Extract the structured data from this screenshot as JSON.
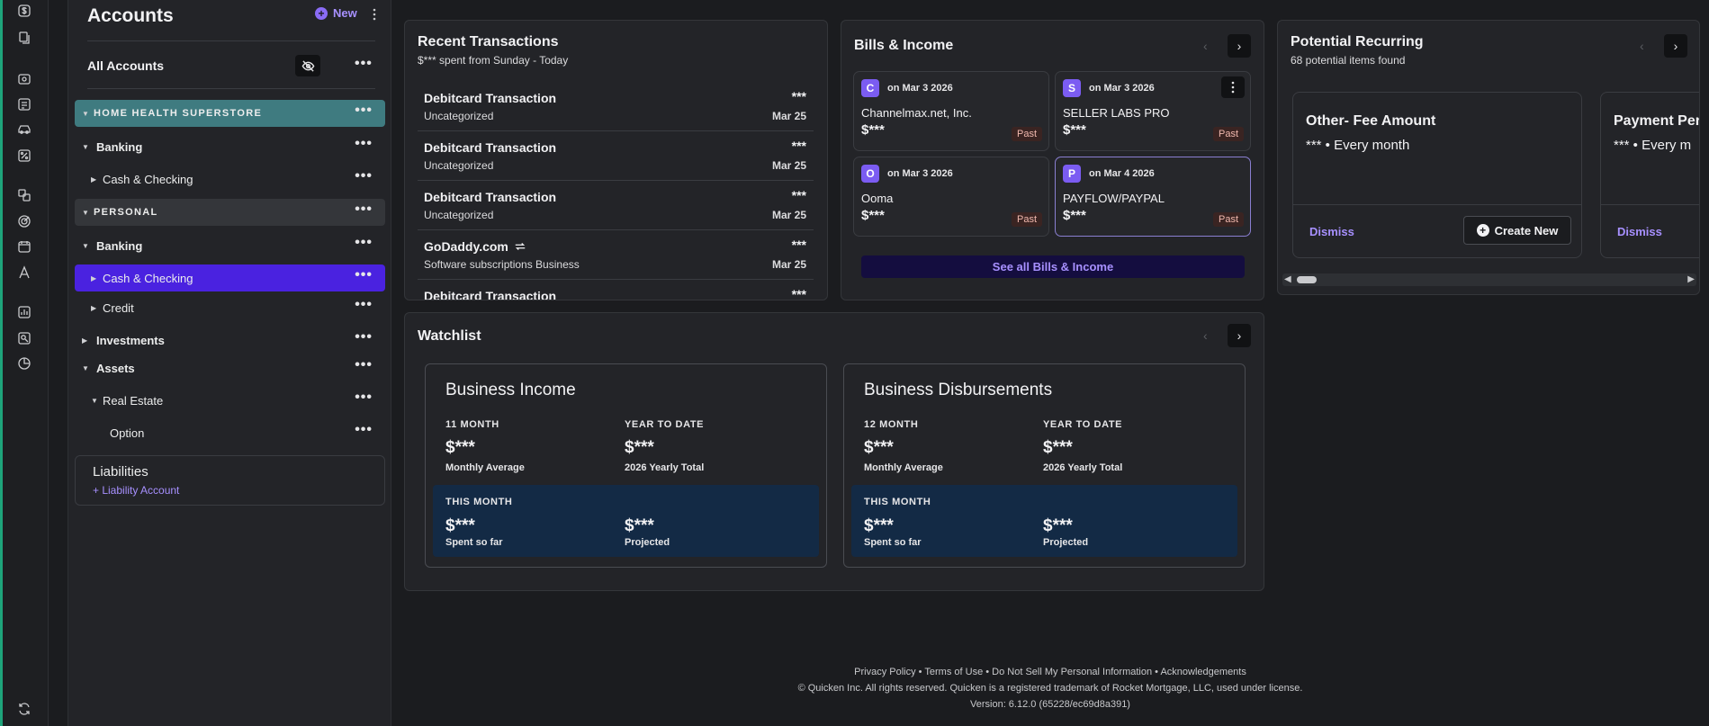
{
  "sidebar": {
    "title": "Accounts",
    "new_label": "New",
    "all_accounts": "All Accounts",
    "rows": [
      {
        "label": "HOME HEALTH SUPERSTORE"
      },
      {
        "label": "Banking"
      },
      {
        "label": "Cash & Checking"
      },
      {
        "label": "PERSONAL"
      },
      {
        "label": "Banking"
      },
      {
        "label": "Cash & Checking"
      },
      {
        "label": "Credit"
      },
      {
        "label": "Investments"
      },
      {
        "label": "Assets"
      },
      {
        "label": "Real Estate"
      },
      {
        "label": "Option"
      }
    ],
    "liabilities_title": "Liabilities",
    "liabilities_link": "+ Liability Account"
  },
  "transactions": {
    "title": "Recent Transactions",
    "subtitle": "$*** spent from Sunday - Today",
    "items": [
      {
        "name": "Debitcard Transaction",
        "category": "Uncategorized",
        "amount": "***",
        "date": "Mar 25"
      },
      {
        "name": "Debitcard Transaction",
        "category": "Uncategorized",
        "amount": "***",
        "date": "Mar 25"
      },
      {
        "name": "Debitcard Transaction",
        "category": "Uncategorized",
        "amount": "***",
        "date": "Mar 25"
      },
      {
        "name": "GoDaddy.com",
        "category": "Software subscriptions Business",
        "amount": "***",
        "date": "Mar 25"
      },
      {
        "name": "Debitcard Transaction",
        "category": "",
        "amount": "***",
        "date": ""
      }
    ]
  },
  "bills": {
    "title": "Bills & Income",
    "items": [
      {
        "initial": "C",
        "on": "on Mar 3 2026",
        "name": "Channelmax.net, Inc.",
        "amount": "$***",
        "status": "Past"
      },
      {
        "initial": "S",
        "on": "on Mar 3 2026",
        "name": "SELLER LABS PRO",
        "amount": "$***",
        "status": "Past"
      },
      {
        "initial": "O",
        "on": "on Mar 3 2026",
        "name": "Ooma",
        "amount": "$***",
        "status": "Past"
      },
      {
        "initial": "P",
        "on": "on Mar 4 2026",
        "name": "PAYFLOW/PAYPAL",
        "amount": "$***",
        "status": "Past"
      }
    ],
    "see_all": "See all Bills & Income"
  },
  "recurring": {
    "title": "Potential Recurring",
    "subtitle": "68 potential items found",
    "items": [
      {
        "title": "Other- Fee Amount",
        "freq": "*** • Every month",
        "dismiss": "Dismiss",
        "create": "Create New"
      },
      {
        "title": "Payment Per",
        "freq": "*** • Every m",
        "dismiss": "Dismiss"
      }
    ]
  },
  "watchlist": {
    "title": "Watchlist",
    "cards": [
      {
        "title": "Business Income",
        "period_label": "11 MONTH",
        "period_value": "$***",
        "period_caption": "Monthly Average",
        "ytd_label": "YEAR TO DATE",
        "ytd_value": "$***",
        "ytd_caption": "2026 Yearly Total",
        "this_month_label": "THIS MONTH",
        "spent_value": "$***",
        "spent_caption": "Spent so far",
        "proj_value": "$***",
        "proj_caption": "Projected"
      },
      {
        "title": "Business Disbursements",
        "period_label": "12 MONTH",
        "period_value": "$***",
        "period_caption": "Monthly Average",
        "ytd_label": "YEAR TO DATE",
        "ytd_value": "$***",
        "ytd_caption": "2026 Yearly Total",
        "this_month_label": "THIS MONTH",
        "spent_value": "$***",
        "spent_caption": "Spent so far",
        "proj_value": "$***",
        "proj_caption": "Projected"
      }
    ]
  },
  "footer": {
    "links": [
      "Privacy Policy",
      "Terms of Use",
      "Do Not Sell My Personal Information",
      "Acknowledgements"
    ],
    "copyright": "© Quicken Inc. All rights reserved. Quicken is a registered trademark of Rocket Mortgage, LLC, used under license.",
    "version": "Version: 6.12.0 (65228/ec69d8a391)"
  },
  "colors": {
    "accent": "#7b5cf2",
    "selected": "#4a22e0",
    "group_teal": "#3f7b80",
    "link": "#a790ff"
  }
}
